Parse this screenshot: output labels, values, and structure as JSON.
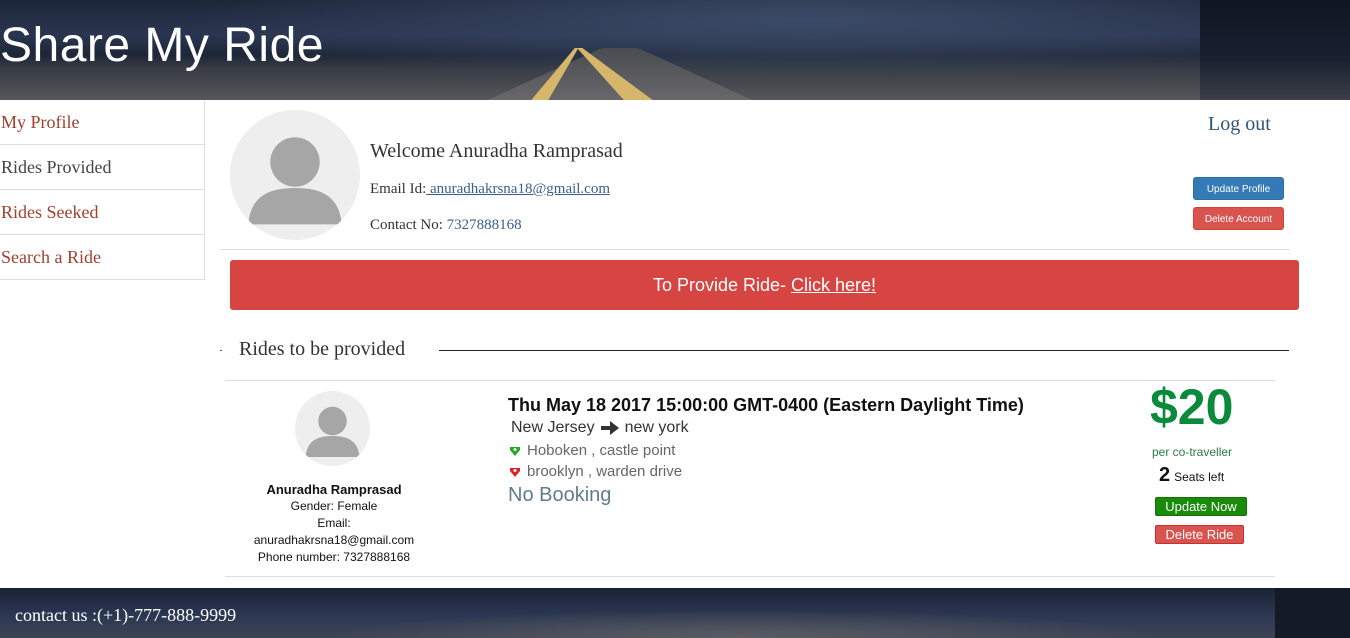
{
  "header": {
    "title": "Share My Ride"
  },
  "sidebar": {
    "items": [
      {
        "label": "My Profile"
      },
      {
        "label": "Rides Provided"
      },
      {
        "label": "Rides Seeked"
      },
      {
        "label": "Search a Ride"
      }
    ]
  },
  "profile": {
    "welcome": "Welcome Anuradha Ramprasad",
    "email_label": "Email Id:",
    "email_value": " anuradhakrsna18@gmail.com",
    "contact_label": "Contact No:",
    "contact_value": "7327888168",
    "logout": "Log out",
    "update_profile": "Update Profile",
    "delete_account": "Delete Account"
  },
  "provide": {
    "text": "To Provide Ride- ",
    "link": "Click here!"
  },
  "section": {
    "title": "Rides to be provided"
  },
  "ride": {
    "owner_name": "Anuradha Ramprasad",
    "gender": "Gender: Female",
    "email_label": "Email:",
    "email": "anuradhakrsna18@gmail.com",
    "phone": "Phone number: 7327888168",
    "datetime": "Thu May 18 2017 15:00:00 GMT-0400 (Eastern Daylight Time)",
    "from": "New Jersey",
    "to": "new york",
    "pickup": "Hoboken , castle point",
    "drop": "brooklyn , warden drive",
    "booking": "No Booking",
    "price": "$20",
    "per": "per co-traveller",
    "seats_count": "2",
    "seats_label": "Seats left",
    "update_now": "Update Now",
    "delete_ride": "Delete Ride",
    "pickup_pin_color": "#22aa22",
    "drop_pin_color": "#dd2222"
  },
  "footer": {
    "contact": "contact us :(+1)-777-888-9999"
  },
  "icons": [
    "avatar-icon",
    "arrow-right-icon",
    "pickup-pin-icon",
    "drop-pin-icon"
  ]
}
